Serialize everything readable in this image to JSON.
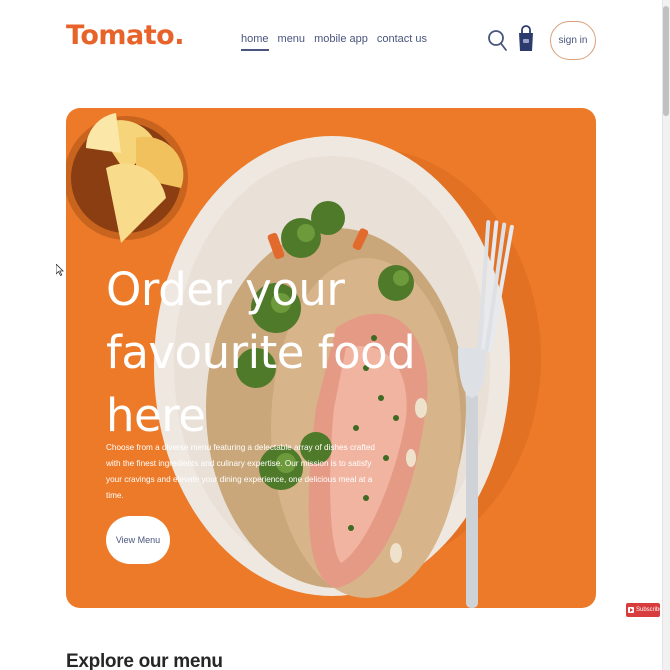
{
  "brand": {
    "logo_text": "Tomato."
  },
  "nav": {
    "links": [
      {
        "label": "home",
        "active": true
      },
      {
        "label": "menu",
        "active": false
      },
      {
        "label": "mobile app",
        "active": false
      },
      {
        "label": "contact us",
        "active": false
      }
    ],
    "icons": [
      "search-icon",
      "basket-icon"
    ],
    "signin_label": "sign in"
  },
  "hero": {
    "heading_line1": "Order your",
    "heading_line2": "favourite food here",
    "description": "Choose from a diverse menu featuring a delectable array of dishes crafted with the finest ingredients and culinary expertise. Our mission is to satisfy your cravings and elevate your dining experience, one delicious meal at a time.",
    "button_label": "View Menu",
    "background_color": "#ec7a28"
  },
  "section": {
    "explore_heading": "Explore our menu"
  },
  "overlay": {
    "subscribe_label": "Subscribe"
  },
  "colors": {
    "brand": "#e8632a",
    "nav_text": "#49557e",
    "hero_bg": "#ec7a28"
  }
}
